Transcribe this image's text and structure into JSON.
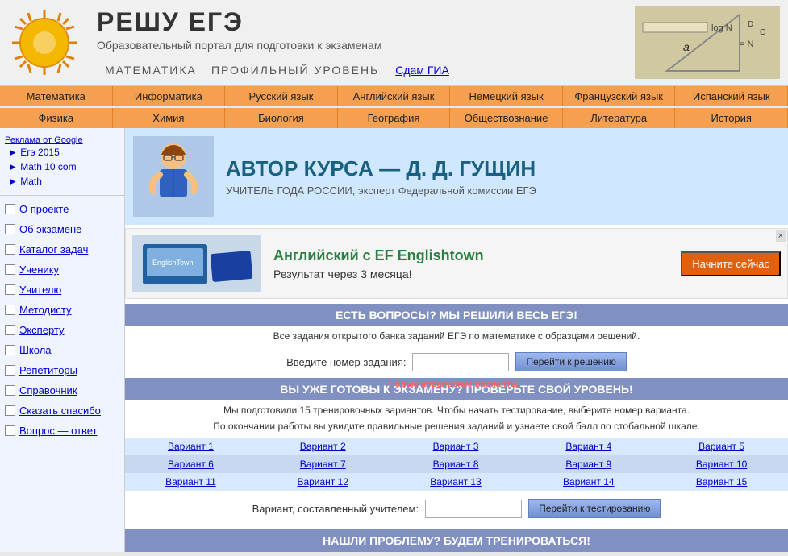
{
  "header": {
    "title": "РЕШУ ЕГЭ",
    "subtitle": "Образовательный портал для подготовки к экзаменам",
    "subject": "МАТЕМАТИКА",
    "level": "ПРОФИЛЬНЫЙ УРОВЕНЬ",
    "gia_link": "Сдам ГИА"
  },
  "nav1": {
    "items": [
      "Математика",
      "Информатика",
      "Русский язык",
      "Английский язык",
      "Немецкий язык",
      "Французский язык",
      "Испанский язык"
    ]
  },
  "nav2": {
    "items": [
      "Физика",
      "Химия",
      "Биология",
      "География",
      "Обществознание",
      "Литература",
      "История"
    ]
  },
  "sidebar": {
    "ads_label": "Реклама от Google",
    "ad_items": [
      "Егэ 2015",
      "Math 10 com",
      "Math"
    ],
    "links": [
      "О проекте",
      "Об экзамене",
      "Каталог задач",
      "Ученику",
      "Учителю",
      "Методисту",
      "Эксперту",
      "Школа",
      "Репетиторы",
      "Справочник",
      "Сказать спасибо",
      "Вопрос — ответ"
    ]
  },
  "banner": {
    "author": "АВТОР КУРСА — Д. Д. ГУЩИН",
    "desc": "УЧИТЕЛЬ ГОДА РОССИИ, эксперт Федеральной комиссии ЕГЭ"
  },
  "ad": {
    "title": "Английский с EF Englishtown",
    "subtitle": "Результат через 3 месяца!",
    "btn": "Начните сейчас",
    "close": "×"
  },
  "section1": {
    "title": "ЕСТЬ ВОПРОСЫ? МЫ РЕШИЛИ ВЕСЬ ЕГЭ!",
    "desc": "Все задания открытого банка заданий ЕГЭ по математике с образцами решений.",
    "label": "Введите номер задания:",
    "btn": "Перейти к решению"
  },
  "section2": {
    "title": "ВЫ УЖЕ ГОТОВЫ К ЭКЗАМЕНУ? ПРОВЕРЬТЕ СВОЙ УРОВЕНЬ!",
    "new_label": "Новые апрельские варианты!",
    "desc1": "Мы подготовили 15 тренировочных вариантов. Чтобы начать тестирование, выберите номер варианта.",
    "desc2": "По окончании работы вы увидите правильные решения заданий и узнаете свой балл по стобальной шкале.",
    "variants": [
      [
        "Вариант 1",
        "Вариант 2",
        "Вариант 3",
        "Вариант 4",
        "Вариант 5"
      ],
      [
        "Вариант 6",
        "Вариант 7",
        "Вариант 8",
        "Вариант 9",
        "Вариант 10"
      ],
      [
        "Вариант 11",
        "Вариант 12",
        "Вариант 13",
        "Вариант 14",
        "Вариант 15"
      ]
    ],
    "teacher_label": "Вариант, составленный учителем:",
    "teacher_btn": "Перейти к тестированию"
  },
  "section3": {
    "title": "НАШЛИ ПРОБЛЕМУ? БУДЕМ ТРЕНИРОВАТЬСЯ!"
  }
}
